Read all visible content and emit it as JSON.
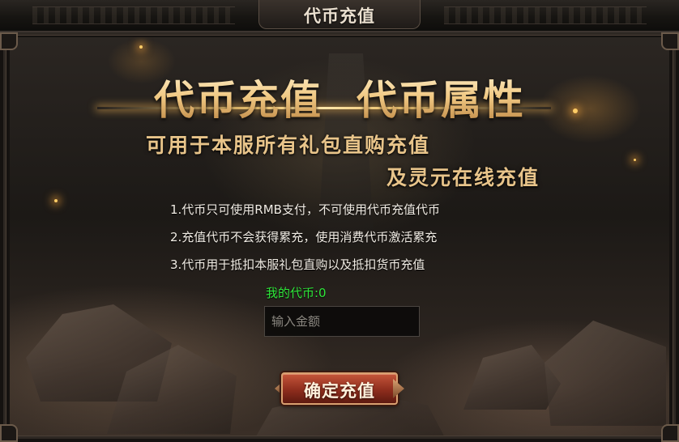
{
  "window": {
    "title": "代币充值"
  },
  "banner": {
    "headline_left": "代币充值",
    "headline_right": "代币属性",
    "subtitle_line1": "可用于本服所有礼包直购充值",
    "subtitle_line2": "及灵元在线充值"
  },
  "rules": [
    "1.代币只可使用RMB支付，不可使用代币充值代币",
    "2.充值代币不会获得累充，使用消费代币激活累充",
    "3.代币用于抵扣本服礼包直购以及抵扣货币充值"
  ],
  "balance": {
    "text": "我的代币:0"
  },
  "amount_input": {
    "value": "",
    "placeholder": "输入金额"
  },
  "confirm_button": {
    "label": "确定充值"
  },
  "colors": {
    "gold": "#f0c882",
    "balance_green": "#2fe63a",
    "button_red": "#8e2d1d"
  }
}
